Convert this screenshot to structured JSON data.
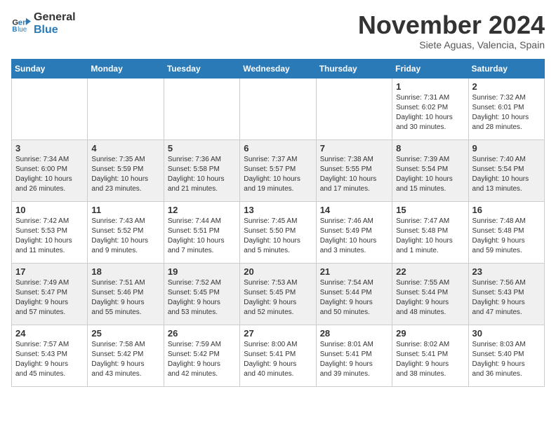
{
  "logo": {
    "line1": "General",
    "line2": "Blue"
  },
  "title": "November 2024",
  "location": "Siete Aguas, Valencia, Spain",
  "weekdays": [
    "Sunday",
    "Monday",
    "Tuesday",
    "Wednesday",
    "Thursday",
    "Friday",
    "Saturday"
  ],
  "weeks": [
    [
      {
        "day": "",
        "info": ""
      },
      {
        "day": "",
        "info": ""
      },
      {
        "day": "",
        "info": ""
      },
      {
        "day": "",
        "info": ""
      },
      {
        "day": "",
        "info": ""
      },
      {
        "day": "1",
        "info": "Sunrise: 7:31 AM\nSunset: 6:02 PM\nDaylight: 10 hours\nand 30 minutes."
      },
      {
        "day": "2",
        "info": "Sunrise: 7:32 AM\nSunset: 6:01 PM\nDaylight: 10 hours\nand 28 minutes."
      }
    ],
    [
      {
        "day": "3",
        "info": "Sunrise: 7:34 AM\nSunset: 6:00 PM\nDaylight: 10 hours\nand 26 minutes."
      },
      {
        "day": "4",
        "info": "Sunrise: 7:35 AM\nSunset: 5:59 PM\nDaylight: 10 hours\nand 23 minutes."
      },
      {
        "day": "5",
        "info": "Sunrise: 7:36 AM\nSunset: 5:58 PM\nDaylight: 10 hours\nand 21 minutes."
      },
      {
        "day": "6",
        "info": "Sunrise: 7:37 AM\nSunset: 5:57 PM\nDaylight: 10 hours\nand 19 minutes."
      },
      {
        "day": "7",
        "info": "Sunrise: 7:38 AM\nSunset: 5:55 PM\nDaylight: 10 hours\nand 17 minutes."
      },
      {
        "day": "8",
        "info": "Sunrise: 7:39 AM\nSunset: 5:54 PM\nDaylight: 10 hours\nand 15 minutes."
      },
      {
        "day": "9",
        "info": "Sunrise: 7:40 AM\nSunset: 5:54 PM\nDaylight: 10 hours\nand 13 minutes."
      }
    ],
    [
      {
        "day": "10",
        "info": "Sunrise: 7:42 AM\nSunset: 5:53 PM\nDaylight: 10 hours\nand 11 minutes."
      },
      {
        "day": "11",
        "info": "Sunrise: 7:43 AM\nSunset: 5:52 PM\nDaylight: 10 hours\nand 9 minutes."
      },
      {
        "day": "12",
        "info": "Sunrise: 7:44 AM\nSunset: 5:51 PM\nDaylight: 10 hours\nand 7 minutes."
      },
      {
        "day": "13",
        "info": "Sunrise: 7:45 AM\nSunset: 5:50 PM\nDaylight: 10 hours\nand 5 minutes."
      },
      {
        "day": "14",
        "info": "Sunrise: 7:46 AM\nSunset: 5:49 PM\nDaylight: 10 hours\nand 3 minutes."
      },
      {
        "day": "15",
        "info": "Sunrise: 7:47 AM\nSunset: 5:48 PM\nDaylight: 10 hours\nand 1 minute."
      },
      {
        "day": "16",
        "info": "Sunrise: 7:48 AM\nSunset: 5:48 PM\nDaylight: 9 hours\nand 59 minutes."
      }
    ],
    [
      {
        "day": "17",
        "info": "Sunrise: 7:49 AM\nSunset: 5:47 PM\nDaylight: 9 hours\nand 57 minutes."
      },
      {
        "day": "18",
        "info": "Sunrise: 7:51 AM\nSunset: 5:46 PM\nDaylight: 9 hours\nand 55 minutes."
      },
      {
        "day": "19",
        "info": "Sunrise: 7:52 AM\nSunset: 5:45 PM\nDaylight: 9 hours\nand 53 minutes."
      },
      {
        "day": "20",
        "info": "Sunrise: 7:53 AM\nSunset: 5:45 PM\nDaylight: 9 hours\nand 52 minutes."
      },
      {
        "day": "21",
        "info": "Sunrise: 7:54 AM\nSunset: 5:44 PM\nDaylight: 9 hours\nand 50 minutes."
      },
      {
        "day": "22",
        "info": "Sunrise: 7:55 AM\nSunset: 5:44 PM\nDaylight: 9 hours\nand 48 minutes."
      },
      {
        "day": "23",
        "info": "Sunrise: 7:56 AM\nSunset: 5:43 PM\nDaylight: 9 hours\nand 47 minutes."
      }
    ],
    [
      {
        "day": "24",
        "info": "Sunrise: 7:57 AM\nSunset: 5:43 PM\nDaylight: 9 hours\nand 45 minutes."
      },
      {
        "day": "25",
        "info": "Sunrise: 7:58 AM\nSunset: 5:42 PM\nDaylight: 9 hours\nand 43 minutes."
      },
      {
        "day": "26",
        "info": "Sunrise: 7:59 AM\nSunset: 5:42 PM\nDaylight: 9 hours\nand 42 minutes."
      },
      {
        "day": "27",
        "info": "Sunrise: 8:00 AM\nSunset: 5:41 PM\nDaylight: 9 hours\nand 40 minutes."
      },
      {
        "day": "28",
        "info": "Sunrise: 8:01 AM\nSunset: 5:41 PM\nDaylight: 9 hours\nand 39 minutes."
      },
      {
        "day": "29",
        "info": "Sunrise: 8:02 AM\nSunset: 5:41 PM\nDaylight: 9 hours\nand 38 minutes."
      },
      {
        "day": "30",
        "info": "Sunrise: 8:03 AM\nSunset: 5:40 PM\nDaylight: 9 hours\nand 36 minutes."
      }
    ]
  ]
}
